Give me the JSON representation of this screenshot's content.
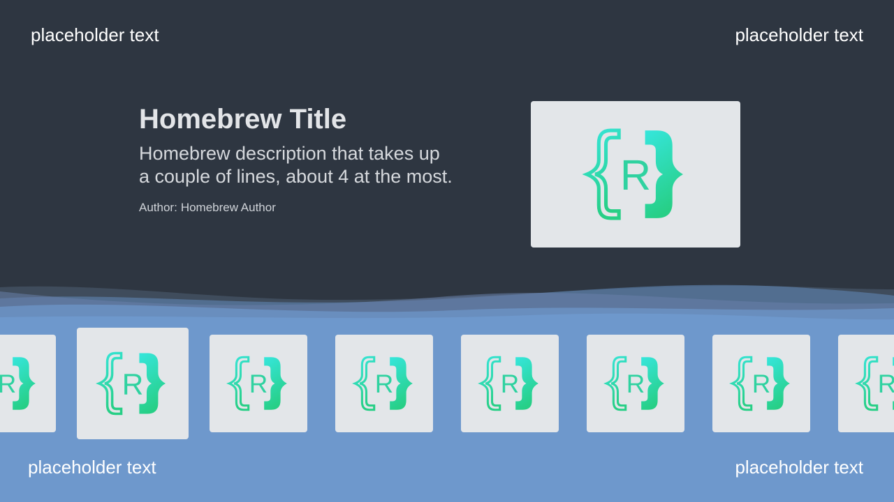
{
  "corners": {
    "top_left": "placeholder text",
    "top_right": "placeholder text",
    "bottom_left": "placeholder text",
    "bottom_right": "placeholder text"
  },
  "homebrew": {
    "title": "Homebrew Title",
    "description": "Homebrew description that takes up a couple of lines, about 4 at the most.",
    "author_label": "Author:",
    "author_name": "Homebrew Author",
    "icon": "bracket-r-logo-icon"
  },
  "carousel": {
    "tile_count": 8,
    "selected_index": 1,
    "icon": "bracket-r-logo-icon"
  },
  "colors": {
    "background_top": "#2e3641",
    "background_bottom": "#6e98cc",
    "tile": "#e3e6e9",
    "logo_gradient_start": "#35e3da",
    "logo_gradient_end": "#29d18a"
  }
}
